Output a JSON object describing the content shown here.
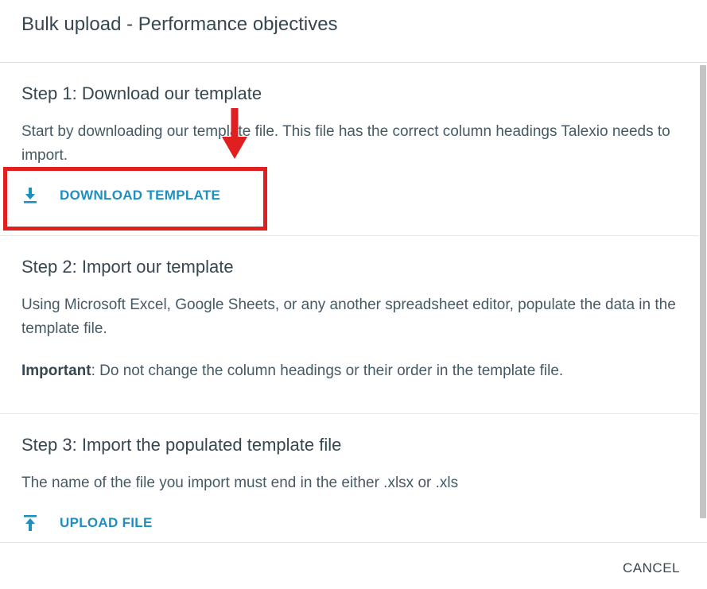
{
  "dialog": {
    "title": "Bulk upload - Performance objectives",
    "cancel_label": "CANCEL"
  },
  "step1": {
    "title": "Step 1: Download our template",
    "text": "Start by downloading our template file. This file has the correct column headings Talexio needs to import.",
    "button_label": "DOWNLOAD TEMPLATE",
    "button_icon": "download-icon"
  },
  "step2": {
    "title": "Step 2: Import our template",
    "text": "Using Microsoft Excel, Google Sheets, or any another spreadsheet editor, populate the data in the template file.",
    "important_label": "Important",
    "important_text": ": Do not change the column headings or their order in the template file."
  },
  "step3": {
    "title": "Step 3: Import the populated template file",
    "text": "The name of the file you import must end in the either .xlsx or .xls",
    "button_label": "UPLOAD FILE",
    "button_icon": "upload-icon"
  },
  "annotation": {
    "color": "#e02020"
  },
  "colors": {
    "accent": "#1f8fbf",
    "text": "#37474f"
  }
}
